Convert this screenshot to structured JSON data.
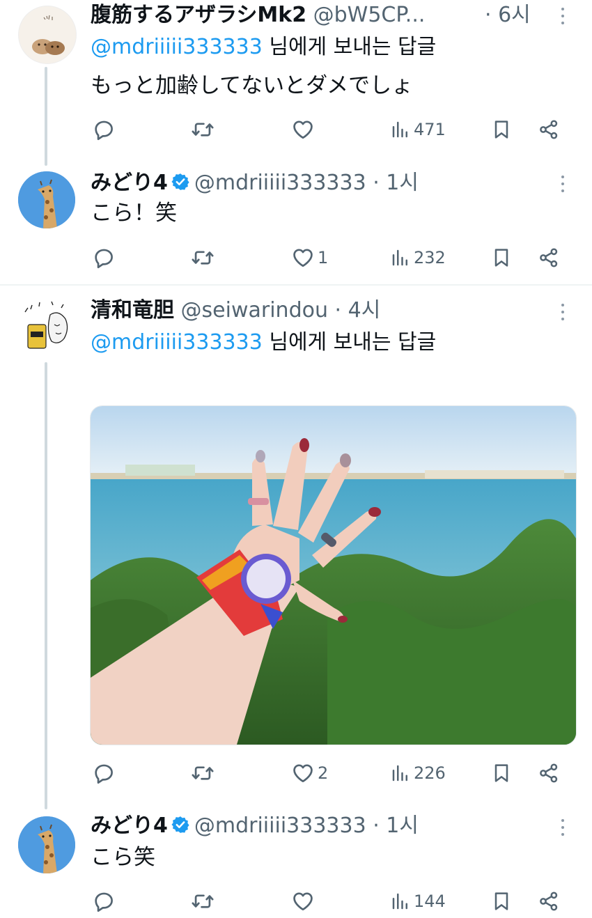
{
  "tweets": [
    {
      "display_name": "腹筋するアザラシMk2",
      "handle": "@bW5CP...",
      "time": "· 6시",
      "reply_label": "님에게 보내는 답글",
      "reply_mention": "@mdriiiii333333",
      "text": "もっと加齢してないとダメでしょ",
      "likes": "",
      "views": "471"
    },
    {
      "display_name": "みどり4",
      "handle": "@mdriiiii333333",
      "time": "· 1시",
      "verified": true,
      "text": "こら！笑",
      "likes": "1",
      "views": "232"
    },
    {
      "display_name": "清和竜胆",
      "handle": "@seiwarindou",
      "time": "· 4시",
      "reply_label": "님에게 보내는 답글",
      "reply_mention": "@mdriiiii333333",
      "text": "",
      "likes": "2",
      "views": "226"
    },
    {
      "display_name": "みどり4",
      "handle": "@mdriiiii333333",
      "time": "· 1시",
      "verified": true,
      "text": "こら笑",
      "likes": "",
      "views": "144"
    }
  ],
  "icons": {
    "reply": "reply-icon",
    "retweet": "retweet-icon",
    "like": "heart-icon",
    "views": "views-icon",
    "bookmark": "bookmark-icon",
    "share": "share-icon",
    "more": "more-icon",
    "verified": "verified-badge-icon"
  },
  "colors": {
    "link": "#1d9bf0",
    "secondary_text": "#536471",
    "verified": "#1d9bf0",
    "divider": "#eff3f4",
    "thread_line": "#cfd9de"
  }
}
